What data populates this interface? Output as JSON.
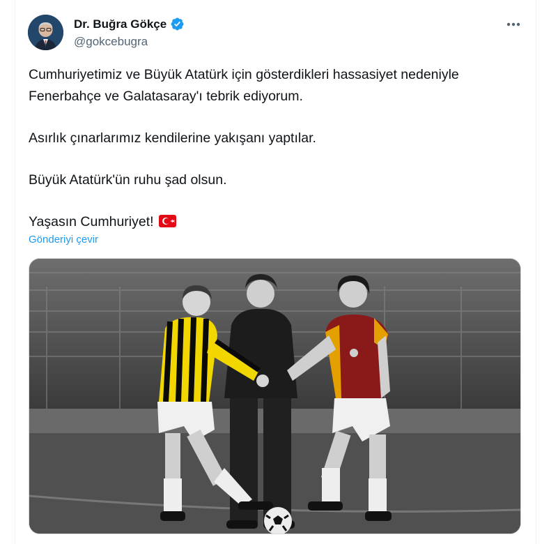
{
  "tweet": {
    "author": {
      "display_name": "Dr. Buğra Gökçe",
      "handle": "@gokcebugra",
      "verified": true,
      "avatar_icon": "avatar"
    },
    "paragraphs": [
      "Cumhuriyetimiz ve Büyük Atatürk için gösterdikleri hassasiyet nedeniyle Fenerbahçe ve Galatasaray'ı tebrik ediyorum.",
      "Asırlık çınarlarımız kendilerine yakışanı yaptılar.",
      "Büyük Atatürk'ün ruhu şad olsun.",
      "Yaşasın Cumhuriyet!"
    ],
    "emoji": "turkey-flag-icon",
    "translate_label": "Gönderiyi çevir",
    "more_icon": "more-options-icon",
    "photo": "black-and-white photo of two footballers in Fenerbahçe and Galatasaray kits shaking hands with a referee between them"
  },
  "colors": {
    "text": "#0f1419",
    "secondary": "#536471",
    "accent": "#1d9bf0",
    "border": "#eff3f4"
  }
}
